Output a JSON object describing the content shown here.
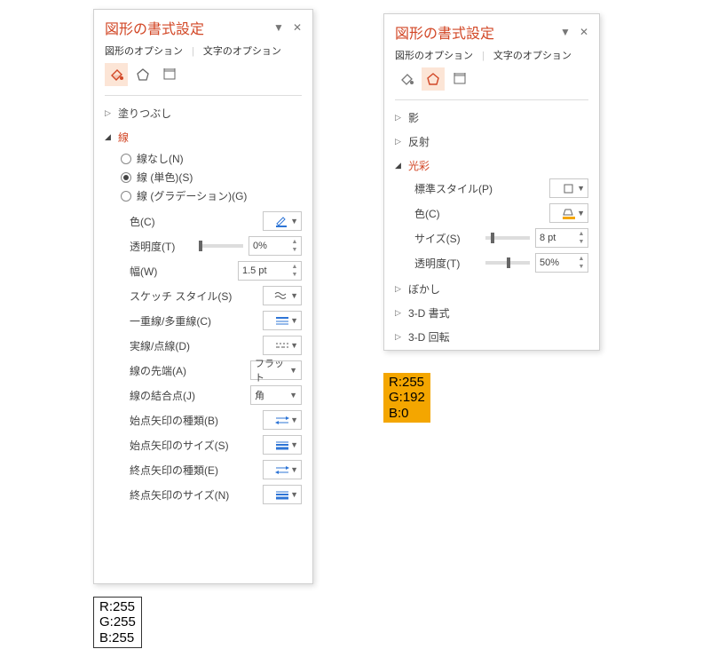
{
  "left": {
    "title": "図形の書式設定",
    "tabs": {
      "shape": "図形のオプション",
      "text": "文字のオプション"
    },
    "fill_section": "塗りつぶし",
    "line_section": "線",
    "line_radios": {
      "none": "線なし(N)",
      "solid": "線 (単色)(S)",
      "gradient": "線 (グラデーション)(G)"
    },
    "props": {
      "color": "色(C)",
      "transparency": "透明度(T)",
      "transparency_val": "0%",
      "width": "幅(W)",
      "width_val": "1.5 pt",
      "sketch": "スケッチ スタイル(S)",
      "compound": "一重線/多重線(C)",
      "dash": "実線/点線(D)",
      "cap": "線の先端(A)",
      "cap_val": "フラット",
      "join": "線の結合点(J)",
      "join_val": "角",
      "beginType": "始点矢印の種類(B)",
      "beginSize": "始点矢印のサイズ(S)",
      "endType": "終点矢印の種類(E)",
      "endSize": "終点矢印のサイズ(N)"
    }
  },
  "right": {
    "title": "図形の書式設定",
    "tabs": {
      "shape": "図形のオプション",
      "text": "文字のオプション"
    },
    "sections": {
      "shadow": "影",
      "reflection": "反射",
      "glow": "光彩",
      "blur": "ぼかし",
      "format3d": "3-D 書式",
      "rotate3d": "3-D 回転"
    },
    "glow": {
      "preset": "標準スタイル(P)",
      "color": "色(C)",
      "size": "サイズ(S)",
      "size_val": "8 pt",
      "transparency": "透明度(T)",
      "transparency_val": "50%"
    }
  },
  "rgb_white": {
    "r": "R:255",
    "g": "G:255",
    "b": "B:255"
  },
  "rgb_amber": {
    "r": "R:255",
    "g": "G:192",
    "b": "B:0"
  }
}
